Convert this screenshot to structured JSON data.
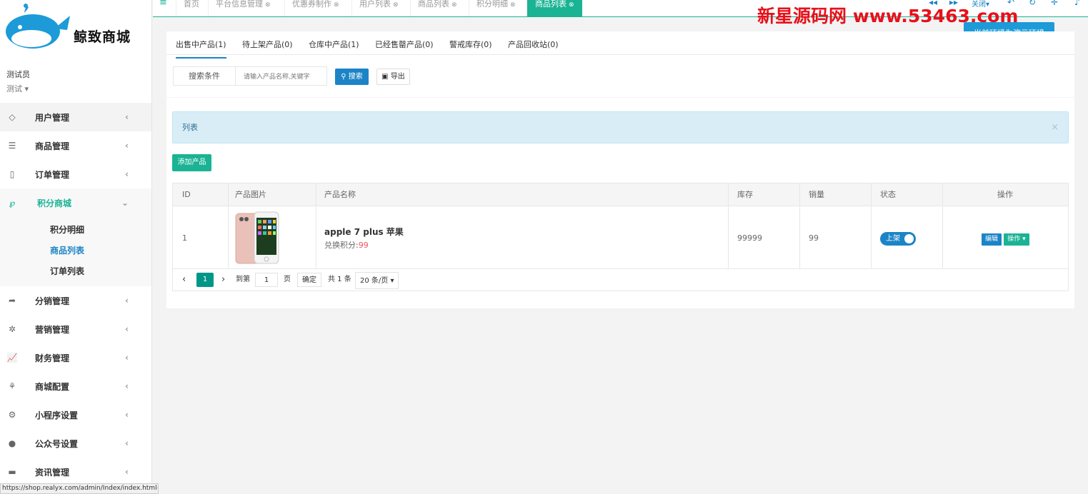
{
  "app": {
    "logo_text": "鲸致商城",
    "user_name": "测试员",
    "user_role": "测试",
    "watermark": "新星源码网 www.53463.com",
    "demo_button": "当前环境为演示环境",
    "status_url": "https://shop.realyx.com/admin/Index/index.html#"
  },
  "sidebar": {
    "items": [
      {
        "label": "用户管理",
        "icon": "diamond-icon"
      },
      {
        "label": "商品管理",
        "icon": "list-icon"
      },
      {
        "label": "订单管理",
        "icon": "tablet-icon"
      },
      {
        "label": "积分商城",
        "icon": "pinterest-icon"
      },
      {
        "label": "分销管理",
        "icon": "share-icon"
      },
      {
        "label": "营销管理",
        "icon": "asterisk-icon"
      },
      {
        "label": "财务管理",
        "icon": "chart-icon"
      },
      {
        "label": "商城配置",
        "icon": "leaf-icon"
      },
      {
        "label": "小程序设置",
        "icon": "cubes-icon"
      },
      {
        "label": "公众号设置",
        "icon": "wechat-icon"
      },
      {
        "label": "资讯管理",
        "icon": "book-icon"
      }
    ],
    "sub_items": [
      "积分明细",
      "商品列表",
      "订单列表"
    ]
  },
  "tabs": [
    {
      "label": "首页"
    },
    {
      "label": "平台信息管理"
    },
    {
      "label": "优惠券制作"
    },
    {
      "label": "用户列表"
    },
    {
      "label": "商品列表"
    },
    {
      "label": "积分明细"
    },
    {
      "label": "商品列表"
    }
  ],
  "top_right": {
    "close_label": "关闭"
  },
  "product_tabs": [
    "出售中产品(1)",
    "待上架产品(0)",
    "仓库中产品(1)",
    "已经售罄产品(0)",
    "警戒库存(0)",
    "产品回收站(0)"
  ],
  "search": {
    "label": "搜索条件",
    "placeholder": "请输入产品名称,关键字",
    "search_button": "搜索",
    "export_button": "导出"
  },
  "alert": {
    "title": "列表",
    "close": "×"
  },
  "add_button": "添加产品",
  "table": {
    "headers": [
      "ID",
      "产品图片",
      "产品名称",
      "库存",
      "销量",
      "状态",
      "操作"
    ],
    "rows": [
      {
        "id": "1",
        "name": "apple 7 plus 苹果",
        "points_label": "兑换积分:",
        "points": "99",
        "stock": "99999",
        "sales": "99",
        "status": "上架",
        "edit": "编辑",
        "action": "操作"
      }
    ]
  },
  "pager": {
    "current": "1",
    "goto_label": "到第",
    "page_input": "1",
    "page_unit": "页",
    "confirm": "确定",
    "total": "共 1 条",
    "per_page": "20 条/页"
  },
  "colors": {
    "accent": "#1ab394",
    "primary": "#1c84c6",
    "watermark": "#e8101a"
  }
}
